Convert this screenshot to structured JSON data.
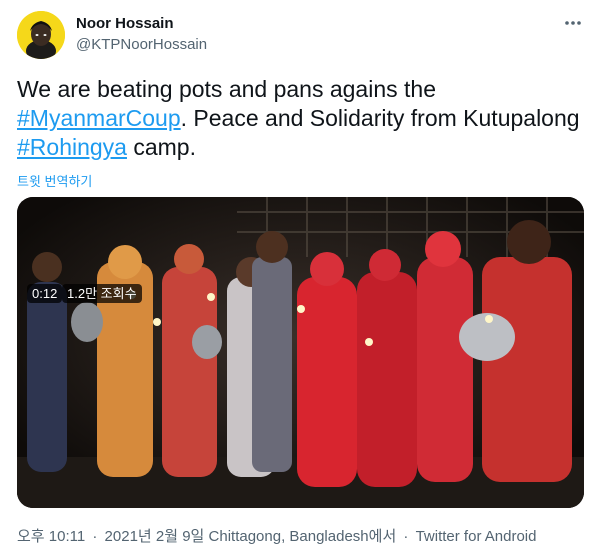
{
  "author": {
    "name": "Noor Hossain",
    "handle": "@KTPNoorHossain"
  },
  "tweet": {
    "text_1": "We are beating pots and pans agains the ",
    "hashtag_1": "#MyanmarCoup",
    "text_2": ". Peace and Solidarity from Kutupalong ",
    "hashtag_2": "#Rohingya",
    "text_3": " camp.",
    "translate_label": "트윗 번역하기"
  },
  "video": {
    "time": "0:12",
    "views": "1.2만 조회수"
  },
  "meta": {
    "time": "오후 10:11",
    "date": "2021년 2월 9일",
    "location": "Chittagong, Bangladesh에서",
    "separator": "·",
    "source": "Twitter for Android"
  },
  "colors": {
    "accent": "#1d9bf0",
    "secondary_text": "#536471",
    "avatar_bg": "#f5d81a"
  },
  "icons": {
    "more": "more-horizontal-icon"
  }
}
